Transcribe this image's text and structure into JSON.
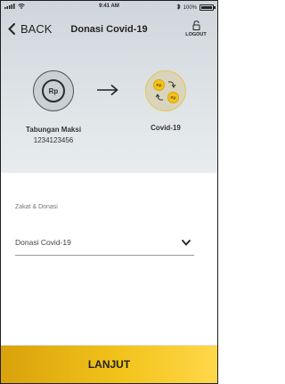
{
  "status_bar": {
    "time": "9:41 AM",
    "battery": "100%"
  },
  "header": {
    "back_label": "BACK",
    "title": "Donasi Covid-19",
    "logout_label": "LOGOUT"
  },
  "account": {
    "name": "Tabungan Maksi",
    "number": "1234123456",
    "badge": "Rp"
  },
  "target": {
    "label": "Covid-19",
    "coin_text": "Rp"
  },
  "form": {
    "field_label": "Zakat & Donasi",
    "selected_value": "Donasi Covid-19"
  },
  "cta": {
    "label": "LANJUT"
  },
  "colors": {
    "accent": "#f2c31b",
    "accent_dark": "#d9a20c"
  }
}
